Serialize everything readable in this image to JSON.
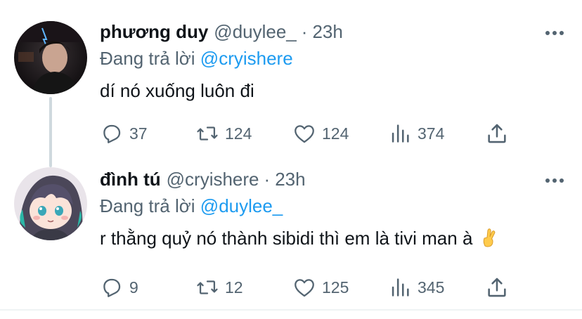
{
  "tweets": [
    {
      "display_name": "phương duy",
      "handle": "@duylee_",
      "separator": "·",
      "time": "23h",
      "replying_prefix": "Đang trả lời",
      "replying_to": "@cryishere",
      "text": "dí nó xuống luôn đi",
      "reply_count": "37",
      "retweet_count": "124",
      "like_count": "124",
      "view_count": "374"
    },
    {
      "display_name": "đình tú",
      "handle": "@cryishere",
      "separator": "·",
      "time": "23h",
      "replying_prefix": "Đang trả lời",
      "replying_to": "@duylee_",
      "text": "r thằng quỷ nó thành sibidi thì em là tivi man à",
      "text_emoji": "crossed-fingers-emoji",
      "reply_count": "9",
      "retweet_count": "12",
      "like_count": "125",
      "view_count": "345"
    }
  ],
  "colors": {
    "text": "#0f1419",
    "secondary": "#536471",
    "accent": "#1d9bf0",
    "thread_line": "#cfd9de"
  },
  "icons": [
    "reply-icon",
    "retweet-icon",
    "like-icon",
    "views-icon",
    "share-icon",
    "more-icon"
  ]
}
